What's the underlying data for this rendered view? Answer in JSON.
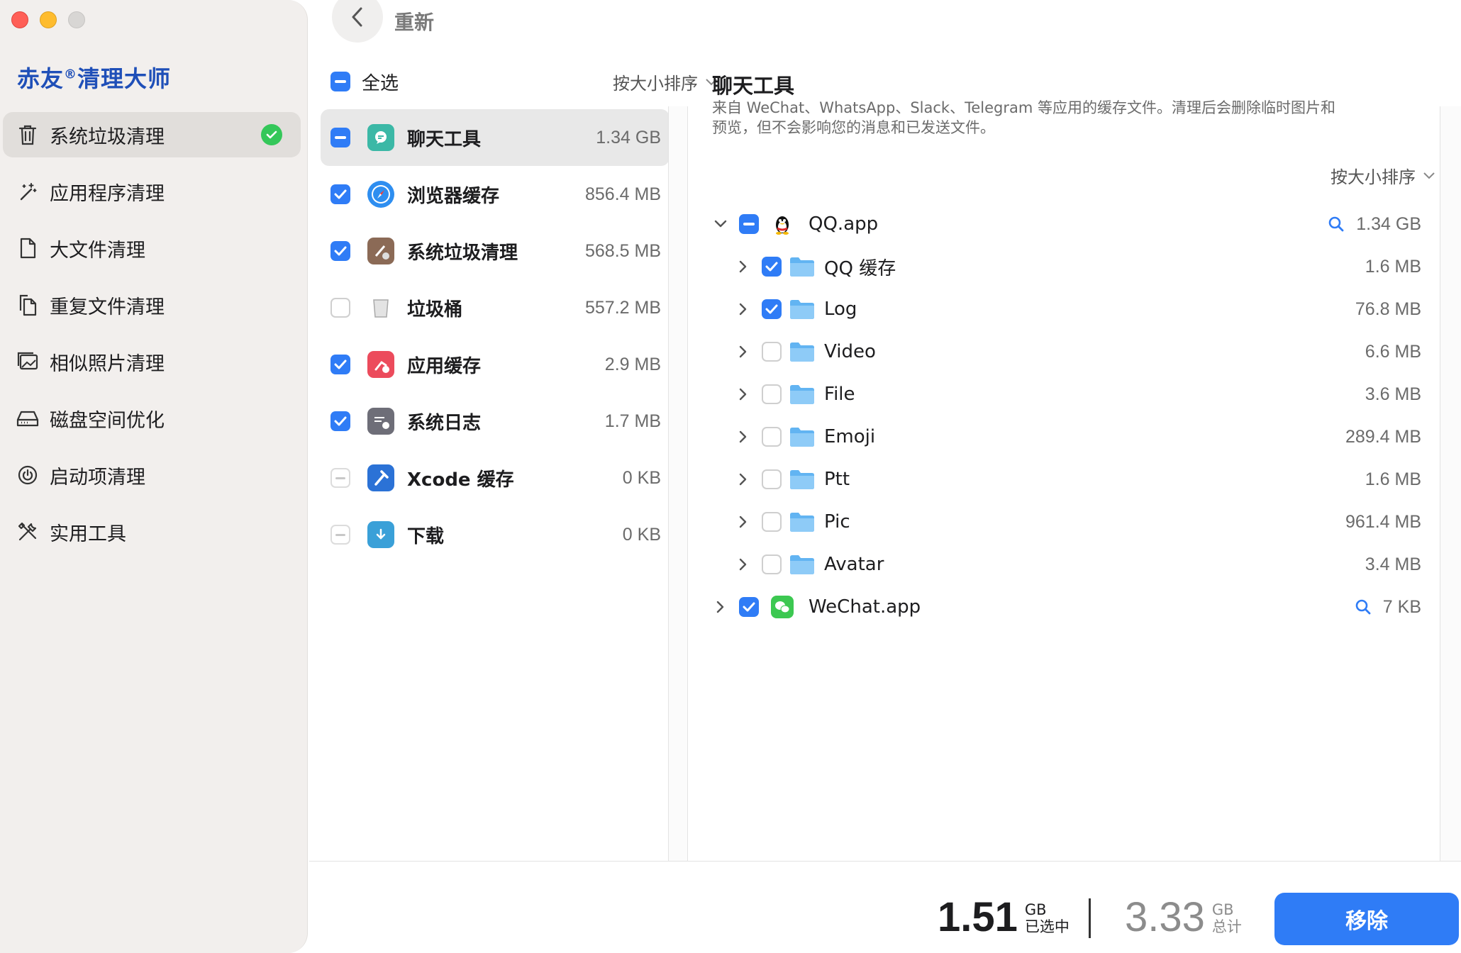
{
  "brand": {
    "name": "赤友",
    "reg": "®",
    "suffix": "清理大师"
  },
  "header": {
    "title": "重新"
  },
  "sidebar": {
    "items": [
      {
        "label": "系统垃圾清理",
        "icon": "trash-icon",
        "active": true,
        "done": true
      },
      {
        "label": "应用程序清理",
        "icon": "magic-wand-icon"
      },
      {
        "label": "大文件清理",
        "icon": "document-icon"
      },
      {
        "label": "重复文件清理",
        "icon": "duplicate-documents-icon"
      },
      {
        "label": "相似照片清理",
        "icon": "photos-icon"
      },
      {
        "label": "磁盘空间优化",
        "icon": "disk-drive-icon"
      },
      {
        "label": "启动项清理",
        "icon": "power-icon"
      },
      {
        "label": "实用工具",
        "icon": "tools-icon"
      }
    ]
  },
  "categories": {
    "select_all": "全选",
    "sort": "按大小排序",
    "items": [
      {
        "label": "聊天工具",
        "size": "1.34 GB",
        "state": "mixed",
        "icon": "chat-bubble-icon",
        "color": "#3bb8a6",
        "active": true
      },
      {
        "label": "浏览器缓存",
        "size": "856.4 MB",
        "state": "on",
        "icon": "safari-compass-icon",
        "color": "#2e8ef0"
      },
      {
        "label": "系统垃圾清理",
        "size": "568.5 MB",
        "state": "on",
        "icon": "system-junk-icon",
        "color": "#8b6a56"
      },
      {
        "label": "垃圾桶",
        "size": "557.2 MB",
        "state": "off",
        "icon": "trash-bin-icon",
        "color": "#bdbdbd"
      },
      {
        "label": "应用缓存",
        "size": "2.9 MB",
        "state": "on",
        "icon": "app-cache-icon",
        "color": "#ec4b5c"
      },
      {
        "label": "系统日志",
        "size": "1.7 MB",
        "state": "on",
        "icon": "system-log-icon",
        "color": "#6e6e78"
      },
      {
        "label": "Xcode 缓存",
        "size": "0 KB",
        "state": "dis",
        "icon": "xcode-hammer-icon",
        "color": "#2b72d6"
      },
      {
        "label": "下载",
        "size": "0 KB",
        "state": "dis",
        "icon": "download-folder-icon",
        "color": "#3aa0d8"
      }
    ]
  },
  "detail": {
    "title": "聊天工具",
    "description": "来自 WeChat、WhatsApp、Slack、Telegram 等应用的缓存文件。清理后会删除临时图片和预览，但不会影响您的消息和已发送文件。",
    "sort": "按大小排序",
    "apps": [
      {
        "name": "QQ.app",
        "size": "1.34 GB",
        "state": "mixed",
        "expanded": true,
        "icon": "qq-penguin-icon",
        "children": [
          {
            "name": "QQ 缓存",
            "size": "1.6 MB",
            "state": "on"
          },
          {
            "name": "Log",
            "size": "76.8 MB",
            "state": "on"
          },
          {
            "name": "Video",
            "size": "6.6 MB",
            "state": "off"
          },
          {
            "name": "File",
            "size": "3.6 MB",
            "state": "off"
          },
          {
            "name": "Emoji",
            "size": "289.4 MB",
            "state": "off"
          },
          {
            "name": "Ptt",
            "size": "1.6 MB",
            "state": "off"
          },
          {
            "name": "Pic",
            "size": "961.4 MB",
            "state": "off"
          },
          {
            "name": "Avatar",
            "size": "3.4 MB",
            "state": "off"
          }
        ]
      },
      {
        "name": "WeChat.app",
        "size": "7 KB",
        "state": "on",
        "expanded": false,
        "icon": "wechat-icon",
        "children": []
      }
    ]
  },
  "footer": {
    "selected_value": "1.51",
    "selected_unit": "GB",
    "selected_label": "已选中",
    "total_value": "3.33",
    "total_unit": "GB",
    "total_label": "总计",
    "remove_label": "移除"
  },
  "colors": {
    "accent": "#2f7cf6",
    "success": "#34c759",
    "brand": "#1f4fb8"
  }
}
